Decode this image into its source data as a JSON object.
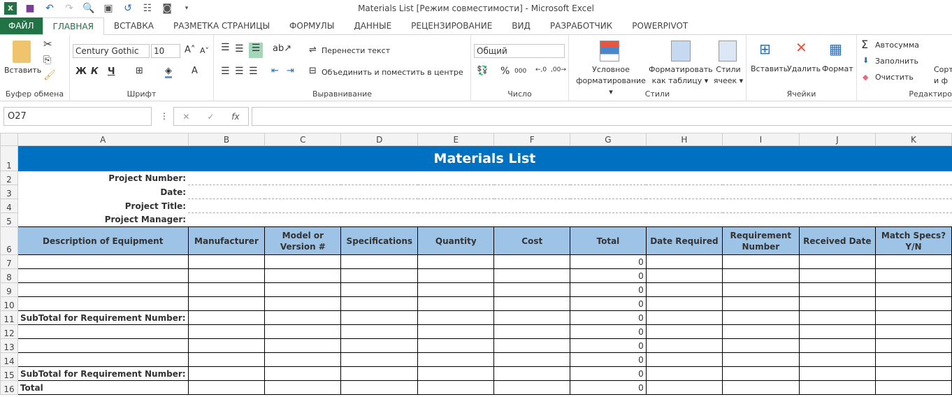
{
  "app": {
    "title": "Materials List  [Режим совместимости] - Microsoft Excel"
  },
  "tabs": [
    "ФАЙЛ",
    "ГЛАВНАЯ",
    "ВСТАВКА",
    "РАЗМЕТКА СТРАНИЦЫ",
    "ФОРМУЛЫ",
    "ДАННЫЕ",
    "РЕЦЕНЗИРОВАНИЕ",
    "ВИД",
    "РАЗРАБОТЧИК",
    "POWERPIVOT"
  ],
  "ribbon": {
    "clipboard": {
      "paste": "Вставить",
      "label": "Буфер обмена"
    },
    "font": {
      "name": "Century Gothic",
      "size": "10",
      "bold": "Ж",
      "italic": "К",
      "underline": "Ч",
      "label": "Шрифт"
    },
    "alignment": {
      "wrap": "Перенести текст",
      "merge": "Объединить и поместить в центре",
      "label": "Выравнивание"
    },
    "number": {
      "format": "Общий",
      "percent": "%",
      "thousands": "000",
      "label": "Число"
    },
    "styles": {
      "conditional1": "Условное",
      "conditional2": "форматирование",
      "table1": "Форматировать",
      "table2": "как таблицу",
      "cell1": "Стили",
      "cell2": "ячеек",
      "label": "Стили"
    },
    "cells": {
      "insert": "Вставить",
      "delete": "Удалить",
      "format": "Формат",
      "label": "Ячейки"
    },
    "editing": {
      "autosum": "Автосумма",
      "fill": "Заполнить",
      "clear": "Очистить",
      "sort1": "Сорт",
      "sort2": "и ф",
      "label": "Редактиро"
    }
  },
  "formula_bar": {
    "name_box": "O27",
    "fx": "fx",
    "value": ""
  },
  "columns": [
    "A",
    "B",
    "C",
    "D",
    "E",
    "F",
    "G",
    "H",
    "I",
    "J",
    "K"
  ],
  "sheet": {
    "title": "Materials List",
    "info_labels": [
      "Project Number:",
      "Date:",
      "Project Title:",
      "Project Manager:"
    ],
    "headers": [
      "Description of Equipment",
      "Manufacturer",
      "Model or Version #",
      "Specifications",
      "Quantity",
      "Cost",
      "Total",
      "Date Required",
      "Requirement Number",
      "Received Date",
      "Match Specs? Y/N"
    ],
    "rows": [
      {
        "n": "7",
        "a": "",
        "g": "0"
      },
      {
        "n": "8",
        "a": "",
        "g": "0"
      },
      {
        "n": "9",
        "a": "",
        "g": "0"
      },
      {
        "n": "10",
        "a": "",
        "g": "0"
      },
      {
        "n": "11",
        "a": "SubTotal for Requirement Number:",
        "g": "0"
      },
      {
        "n": "12",
        "a": "",
        "g": "0"
      },
      {
        "n": "13",
        "a": "",
        "g": "0"
      },
      {
        "n": "14",
        "a": "",
        "g": "0"
      },
      {
        "n": "15",
        "a": "SubTotal for Requirement Number:",
        "g": "0"
      },
      {
        "n": "16",
        "a": "Total",
        "g": "0"
      }
    ]
  },
  "colors": {
    "file_tab": "#217346",
    "title_fill": "#0070c0",
    "header_fill": "#9dc3e6"
  }
}
